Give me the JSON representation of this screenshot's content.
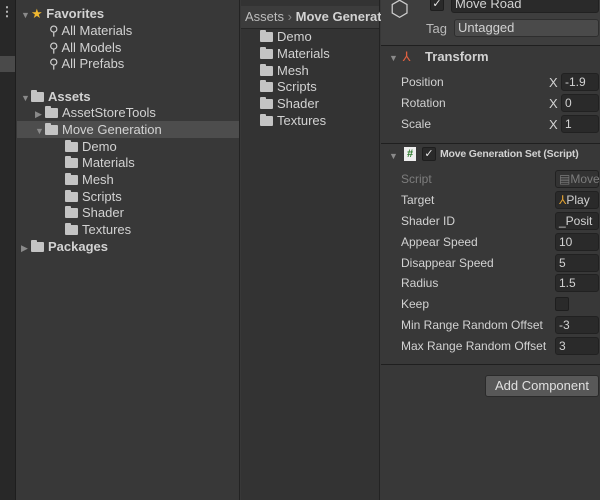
{
  "tree": {
    "favorites": "Favorites",
    "favorite_items": [
      "All Materials",
      "All Models",
      "All Prefabs"
    ],
    "assets": "Assets",
    "asset_store_tools": "AssetStoreTools",
    "move_generation": "Move Generation",
    "subfolders": [
      "Demo",
      "Materials",
      "Mesh",
      "Scripts",
      "Shader",
      "Textures"
    ],
    "packages": "Packages"
  },
  "list": {
    "breadcrumb": [
      "Assets",
      "Move Generation"
    ],
    "folders": [
      "Demo",
      "Materials",
      "Mesh",
      "Scripts",
      "Shader",
      "Textures"
    ]
  },
  "inspector": {
    "object_name": "Move Road",
    "tag_label": "Tag",
    "tag_value": "Untagged",
    "transform": {
      "title": "Transform",
      "rows": [
        {
          "label": "Position",
          "axis": "X",
          "value": "-1.9"
        },
        {
          "label": "Rotation",
          "axis": "X",
          "value": "0"
        },
        {
          "label": "Scale",
          "axis": "X",
          "value": "1"
        }
      ]
    },
    "component": {
      "title": "Move Generation Set (Script)",
      "rows": [
        {
          "label": "Script",
          "value": "Move"
        },
        {
          "label": "Target",
          "value": "Play"
        },
        {
          "label": "Shader ID",
          "value": "_Posit"
        },
        {
          "label": "Appear Speed",
          "value": "10"
        },
        {
          "label": "Disappear Speed",
          "value": "5"
        },
        {
          "label": "Radius",
          "value": "1.5"
        },
        {
          "label": "Keep",
          "value": ""
        },
        {
          "label": "Min Range Random Offset",
          "value": "-3"
        },
        {
          "label": "Max Range Random Offset",
          "value": "3"
        }
      ]
    },
    "add_component": "Add Component"
  }
}
